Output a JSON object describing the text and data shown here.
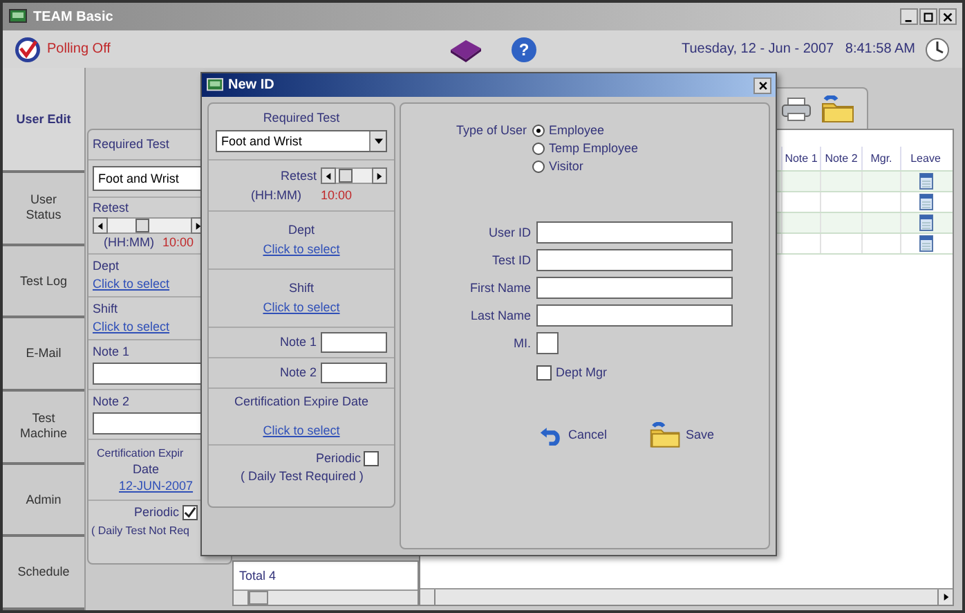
{
  "window": {
    "title": "TEAM Basic"
  },
  "toolbar": {
    "polling": "Polling Off",
    "help": "?",
    "datetime": "Tuesday, 12 - Jun - 2007   8:41:58 AM"
  },
  "nav": [
    {
      "label": "User Edit",
      "selected": true
    },
    {
      "label": "User Status",
      "selected": false
    },
    {
      "label": "Test Log",
      "selected": false
    },
    {
      "label": "E-Mail",
      "selected": false
    },
    {
      "label": "Test Machine",
      "selected": false
    },
    {
      "label": "Admin",
      "selected": false
    },
    {
      "label": "Schedule",
      "selected": false
    }
  ],
  "back_form": {
    "required_test_label": "Required Test",
    "required_test": "Foot and Wrist",
    "retest": {
      "label": "Retest",
      "format": "(HH:MM)",
      "value": "10:00",
      "level": 0.4
    },
    "dept": {
      "label": "Dept",
      "link": "Click to select"
    },
    "shift": {
      "label": "Shift",
      "link": "Click to select"
    },
    "notes": [
      {
        "label": "Note 1"
      },
      {
        "label": "Note 2"
      }
    ],
    "cert": {
      "label": "Certification Expir",
      "label_2": "Date",
      "date": "12-JUN-2007"
    },
    "periodic": {
      "label": "Periodic",
      "checked": true,
      "note": "( Daily Test Not Req"
    }
  },
  "list": {
    "total": "Total 4"
  },
  "table": {
    "columns": [
      "Note 1",
      "Note 2",
      "Mgr.",
      "Leave"
    ],
    "rows": [
      {
        "kind": "leave"
      },
      {
        "kind": "leave"
      },
      {
        "kind": "leave"
      },
      {
        "kind": "leave"
      }
    ]
  },
  "dialog": {
    "title": "New ID",
    "required_test_label": "Required Test",
    "required_test": "Foot and Wrist",
    "retest": {
      "label": "Retest",
      "format": "(HH:MM)",
      "value": "10:00",
      "level": 0.1
    },
    "dept": {
      "label": "Dept",
      "link": "Click to select"
    },
    "shift": {
      "label": "Shift",
      "link": "Click to select"
    },
    "notes": [
      {
        "label": "Note 1"
      },
      {
        "label": "Note 2"
      }
    ],
    "cert": {
      "label": "Certification Expire Date",
      "link": "Click to select"
    },
    "periodic": {
      "label": "Periodic",
      "checked": false,
      "note": "( Daily Test Required )"
    },
    "user_type": {
      "label": "Type of User",
      "options": [
        {
          "label": "Employee",
          "selected": true
        },
        {
          "label": "Temp Employee",
          "selected": false
        },
        {
          "label": "Visitor",
          "selected": false
        }
      ]
    },
    "fields": [
      {
        "label": "User ID",
        "kind": "wide"
      },
      {
        "label": "Test ID",
        "kind": "wide"
      },
      {
        "label": "First Name",
        "kind": "wide"
      },
      {
        "label": "Last Name",
        "kind": "wide"
      },
      {
        "label": "MI.",
        "kind": "short"
      }
    ],
    "dept_mgr": {
      "label": "Dept Mgr",
      "checked": false
    },
    "buttons": [
      {
        "label": "Cancel",
        "kind": "cancel"
      },
      {
        "label": "Save",
        "kind": "save"
      }
    ]
  }
}
